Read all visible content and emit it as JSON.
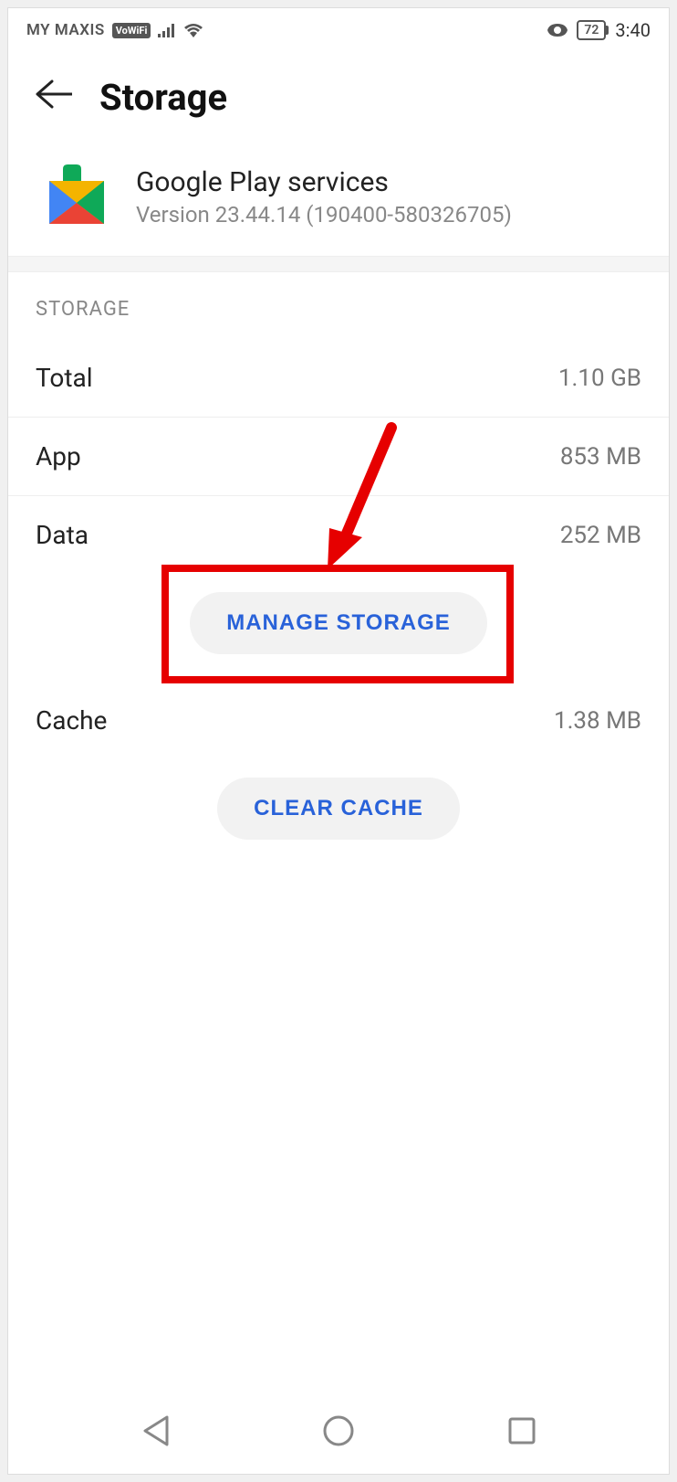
{
  "statusBar": {
    "carrier": "MY MAXIS",
    "vowifi": "VoWiFi",
    "battery": "72",
    "time": "3:40"
  },
  "header": {
    "title": "Storage"
  },
  "app": {
    "name": "Google Play services",
    "version": "Version 23.44.14 (190400-580326705)"
  },
  "section": {
    "label": "STORAGE"
  },
  "storage": {
    "total": {
      "label": "Total",
      "value": "1.10 GB"
    },
    "app": {
      "label": "App",
      "value": "853 MB"
    },
    "data": {
      "label": "Data",
      "value": "252 MB"
    },
    "cache": {
      "label": "Cache",
      "value": "1.38 MB"
    }
  },
  "buttons": {
    "manageStorage": "MANAGE STORAGE",
    "clearCache": "CLEAR CACHE"
  }
}
